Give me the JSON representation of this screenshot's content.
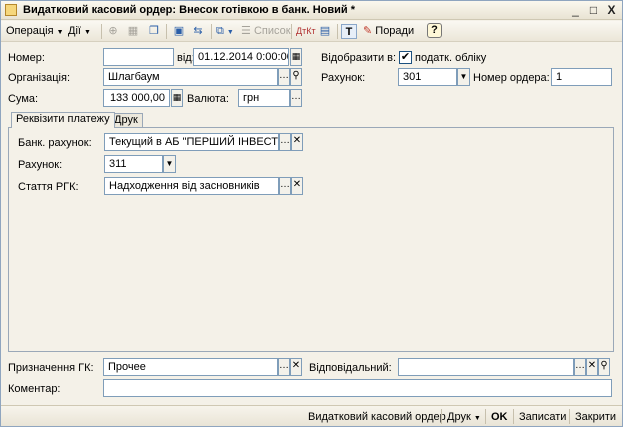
{
  "window": {
    "title": "Видатковий касовий ордер: Внесок готівкою в банк. Новий *",
    "minimize": "_",
    "maximize": "□",
    "close": "X"
  },
  "toolbar": {
    "operation": "Операція",
    "actions": "Дії",
    "list": "Список",
    "tips": "Поради",
    "help": "?"
  },
  "form": {
    "number_label": "Номер:",
    "number_value": "",
    "date_label": "від:",
    "date_value": "01.12.2014  0:00:00",
    "reflect_label": "Відобразити в:",
    "tax_checkbox_label": "податк. обліку",
    "tax_checked": "✔",
    "org_label": "Організація:",
    "org_value": "Шлагбаум",
    "account_label": "Рахунок:",
    "account_value": "301",
    "order_no_label": "Номер ордера:",
    "order_no_value": "1",
    "sum_label": "Сума:",
    "sum_value": "133 000,00",
    "currency_label": "Валюта:",
    "currency_value": "грн"
  },
  "tabs": [
    {
      "label": "Реквізити платежу"
    },
    {
      "label": "Друк"
    }
  ],
  "payment": {
    "bank_account_label": "Банк. рахунок:",
    "bank_account_value": "Текущий в АБ \"ПЕРШИЙ ІНВЕСТИЦІ",
    "account_label": "Рахунок:",
    "account_value": "311",
    "rgk_label": "Стаття РГК:",
    "rgk_value": "Надходження від засновників"
  },
  "footer_form": {
    "purpose_label": "Призначення ГК:",
    "purpose_value": "Прочее",
    "responsible_label": "Відповідальний:",
    "responsible_value": "",
    "comment_label": "Коментар:",
    "comment_value": ""
  },
  "bottombar": {
    "doc_link": "Видатковий касовий ордер",
    "print": "Друк",
    "ok": "OK",
    "save": "Записати",
    "close": "Закрити"
  }
}
